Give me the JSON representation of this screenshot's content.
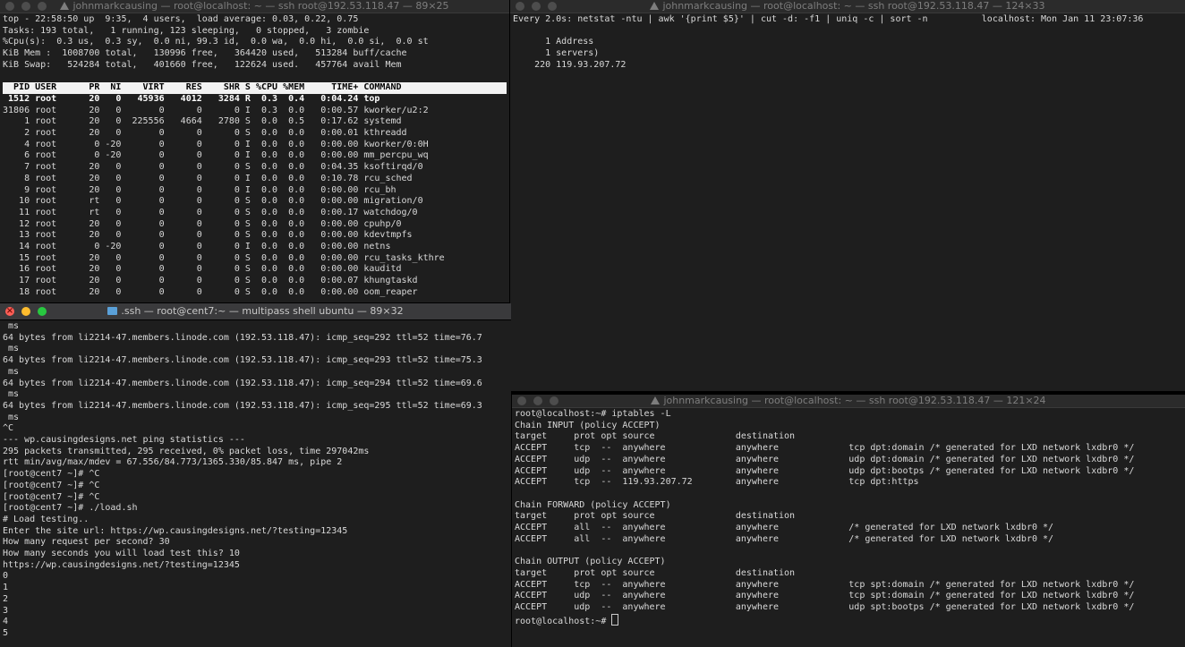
{
  "windows": {
    "top": {
      "title": "johnmarkcausing — root@localhost: ~ — ssh root@192.53.118.47 — 89×25",
      "summary": [
        "top - 22:58:50 up  9:35,  4 users,  load average: 0.03, 0.22, 0.75",
        "Tasks: 193 total,   1 running, 123 sleeping,   0 stopped,   3 zombie",
        "%Cpu(s):  0.3 us,  0.3 sy,  0.0 ni, 99.3 id,  0.0 wa,  0.0 hi,  0.0 si,  0.0 st",
        "KiB Mem :  1008700 total,   130996 free,   364420 used,   513284 buff/cache",
        "KiB Swap:   524284 total,   401660 free,   122624 used.   457764 avail Mem"
      ],
      "header": "  PID USER      PR  NI    VIRT    RES    SHR S %CPU %MEM     TIME+ COMMAND          ",
      "processes": [
        " 1512 root      20   0   45936   4012   3284 R  0.3  0.4   0:04.24 top",
        "31806 root      20   0       0      0      0 I  0.3  0.0   0:00.57 kworker/u2:2",
        "    1 root      20   0  225556   4664   2780 S  0.0  0.5   0:17.62 systemd",
        "    2 root      20   0       0      0      0 S  0.0  0.0   0:00.01 kthreadd",
        "    4 root       0 -20       0      0      0 I  0.0  0.0   0:00.00 kworker/0:0H",
        "    6 root       0 -20       0      0      0 I  0.0  0.0   0:00.00 mm_percpu_wq",
        "    7 root      20   0       0      0      0 S  0.0  0.0   0:04.35 ksoftirqd/0",
        "    8 root      20   0       0      0      0 I  0.0  0.0   0:10.78 rcu_sched",
        "    9 root      20   0       0      0      0 I  0.0  0.0   0:00.00 rcu_bh",
        "   10 root      rt   0       0      0      0 S  0.0  0.0   0:00.00 migration/0",
        "   11 root      rt   0       0      0      0 S  0.0  0.0   0:00.17 watchdog/0",
        "   12 root      20   0       0      0      0 S  0.0  0.0   0:00.00 cpuhp/0",
        "   13 root      20   0       0      0      0 S  0.0  0.0   0:00.00 kdevtmpfs",
        "   14 root       0 -20       0      0      0 I  0.0  0.0   0:00.00 netns",
        "   15 root      20   0       0      0      0 S  0.0  0.0   0:00.00 rcu_tasks_kthre",
        "   16 root      20   0       0      0      0 S  0.0  0.0   0:00.00 kauditd",
        "   17 root      20   0       0      0      0 S  0.0  0.0   0:00.07 khungtaskd",
        "   18 root      20   0       0      0      0 S  0.0  0.0   0:00.00 oom_reaper"
      ]
    },
    "netstat": {
      "title": "johnmarkcausing — root@localhost: ~ — ssh root@192.53.118.47 — 124×33",
      "lines": [
        "Every 2.0s: netstat -ntu | awk '{print $5}' | cut -d: -f1 | uniq -c | sort -n          localhost: Mon Jan 11 23:07:36",
        "",
        "      1 Address",
        "      1 servers)",
        "    220 119.93.207.72"
      ]
    },
    "multipass": {
      "title": ".ssh — root@cent7:~ — multipass shell ubuntu — 89×32",
      "lines": [
        " ms",
        "64 bytes from li2214-47.members.linode.com (192.53.118.47): icmp_seq=292 ttl=52 time=76.7",
        " ms",
        "64 bytes from li2214-47.members.linode.com (192.53.118.47): icmp_seq=293 ttl=52 time=75.3",
        " ms",
        "64 bytes from li2214-47.members.linode.com (192.53.118.47): icmp_seq=294 ttl=52 time=69.6",
        " ms",
        "64 bytes from li2214-47.members.linode.com (192.53.118.47): icmp_seq=295 ttl=52 time=69.3",
        " ms",
        "^C",
        "--- wp.causingdesigns.net ping statistics ---",
        "295 packets transmitted, 295 received, 0% packet loss, time 297042ms",
        "rtt min/avg/max/mdev = 67.556/84.773/1365.330/85.847 ms, pipe 2",
        "[root@cent7 ~]# ^C",
        "[root@cent7 ~]# ^C",
        "[root@cent7 ~]# ^C",
        "[root@cent7 ~]# ./load.sh",
        "# Load testing..",
        "Enter the site url: https://wp.causingdesigns.net/?testing=12345",
        "How many request per second? 30",
        "How many seconds you will load test this? 10",
        "https://wp.causingdesigns.net/?testing=12345",
        "0",
        "1",
        "2",
        "3",
        "4",
        "5"
      ]
    },
    "iptables": {
      "title": "johnmarkcausing — root@localhost: ~ — ssh root@192.53.118.47 — 121×24",
      "lines": [
        "root@localhost:~# iptables -L",
        "Chain INPUT (policy ACCEPT)",
        "target     prot opt source               destination",
        "ACCEPT     tcp  --  anywhere             anywhere             tcp dpt:domain /* generated for LXD network lxdbr0 */",
        "ACCEPT     udp  --  anywhere             anywhere             udp dpt:domain /* generated for LXD network lxdbr0 */",
        "ACCEPT     udp  --  anywhere             anywhere             udp dpt:bootps /* generated for LXD network lxdbr0 */",
        "ACCEPT     tcp  --  119.93.207.72        anywhere             tcp dpt:https",
        "",
        "Chain FORWARD (policy ACCEPT)",
        "target     prot opt source               destination",
        "ACCEPT     all  --  anywhere             anywhere             /* generated for LXD network lxdbr0 */",
        "ACCEPT     all  --  anywhere             anywhere             /* generated for LXD network lxdbr0 */",
        "",
        "Chain OUTPUT (policy ACCEPT)",
        "target     prot opt source               destination",
        "ACCEPT     tcp  --  anywhere             anywhere             tcp spt:domain /* generated for LXD network lxdbr0 */",
        "ACCEPT     udp  --  anywhere             anywhere             tcp spt:domain /* generated for LXD network lxdbr0 */",
        "ACCEPT     udp  --  anywhere             anywhere             udp spt:bootps /* generated for LXD network lxdbr0 */"
      ],
      "prompt": "root@localhost:~# "
    }
  }
}
